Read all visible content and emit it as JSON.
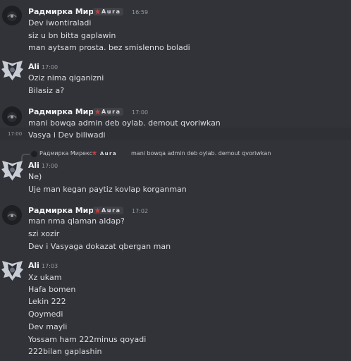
{
  "users": {
    "radmirka": "Радмирка Мирекс",
    "ali": "Ali"
  },
  "tag_text": "Aura",
  "messages": [
    {
      "time": "16:59",
      "lines": [
        "Dev iwontiraladi",
        "siz u bn bitta gaplawin",
        "man aytsam prosta. bez smislenno boladi"
      ]
    },
    {
      "time": "17:00",
      "lines": [
        "Oziz nima qiganizni",
        "Bilasiz a?"
      ]
    },
    {
      "time": "17:00",
      "lines": [
        "mani bowqa admin deb oylab. demout qvoriwkan"
      ],
      "hover_time": "17:00",
      "hover_line": "Vasya i Dev biliwadi"
    },
    {
      "time": "17:00",
      "reply_text": "mani bowqa admin deb oylab. demout qvoriwkan",
      "lines": [
        "Ne)",
        "Uje man kegan paytiz kovlap korganman"
      ]
    },
    {
      "time": "17:02",
      "lines": [
        "man nma qlaman aldap?",
        "szi xozir",
        "Dev i Vasyaga dokazat qbergan man"
      ]
    },
    {
      "time": "17:03",
      "lines": [
        "Xz ukam",
        "Hafa bomen",
        "Lekin 222",
        "Qoymedi",
        "Dev mayli",
        "Yossam ham 222minus qoyadi",
        "222bilan gaplashin"
      ]
    }
  ],
  "colors": {
    "background": "#313338",
    "text": "#dbdee1",
    "muted": "#949ba4",
    "tag_bg": "#3f4147",
    "tag_icon": "#d13a3a"
  }
}
